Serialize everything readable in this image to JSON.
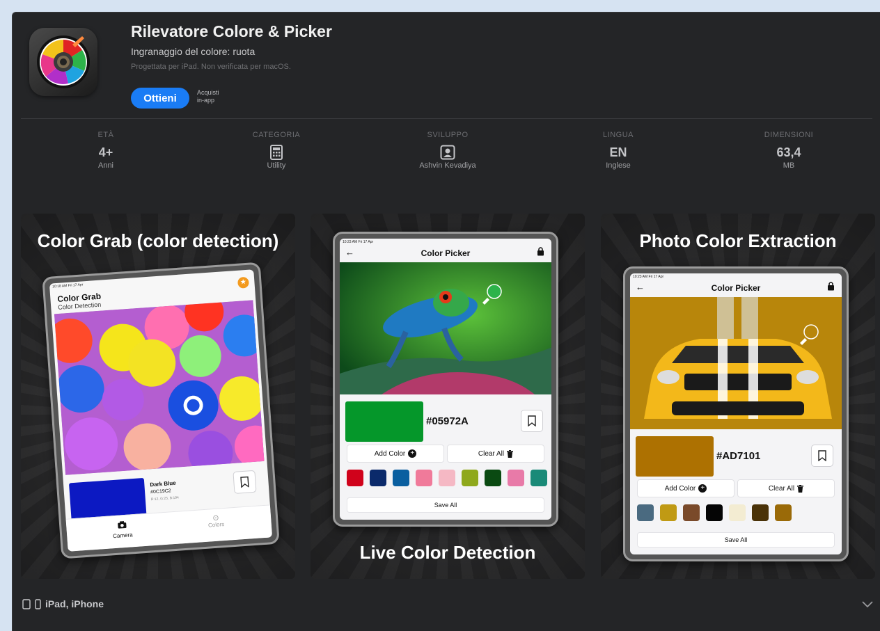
{
  "app": {
    "title": "Rilevatore Colore & Picker",
    "subtitle": "Ingranaggio del colore: ruota",
    "compat": "Progettata per iPad. Non verificata per macOS.",
    "get_label": "Ottieni",
    "iap_line1": "Acquisti",
    "iap_line2": "in-app",
    "accent": "#1a7cf5"
  },
  "info": [
    {
      "label": "ETÀ",
      "value": "4+",
      "sub": "Anni"
    },
    {
      "label": "CATEGORIA",
      "icon": "calculator-icon",
      "sub": "Utility"
    },
    {
      "label": "SVILUPPO",
      "icon": "person-icon",
      "sub": "Ashvin Kevadiya"
    },
    {
      "label": "LINGUA",
      "value": "EN",
      "sub": "Inglese"
    },
    {
      "label": "DIMENSIONI",
      "value": "63,4",
      "sub": "MB"
    }
  ],
  "shots": {
    "s1": {
      "title": "Color Grab (color detection)",
      "time": "10:18 AM  Fri 17 Apr",
      "heading": "Color Grab",
      "subheading": "Color Detection",
      "color_name": "Dark Blue",
      "color_hex": "#0C19C2",
      "color_rgb": "R:12, G:25, B:194",
      "swatch": "#0c19c2",
      "tab_camera": "Camera",
      "tab_colors": "Colors"
    },
    "s2": {
      "caption": "Live Color Detection",
      "time": "10:23 AM  Fri 17 Apr",
      "nav_title": "Color Picker",
      "hex": "#05972A",
      "swatch": "#05972a",
      "add_color": "Add Color",
      "clear_all": "Clear All",
      "save_all": "Save All",
      "palette": [
        "#d0021b",
        "#0b2a6b",
        "#0a5fa0",
        "#f07a9a",
        "#f5b8c4",
        "#8fa81c",
        "#0a4a12",
        "#e87aa8",
        "#1a8a78"
      ]
    },
    "s3": {
      "title": "Photo Color Extraction",
      "time": "10:23 AM  Fri 17 Apr",
      "nav_title": "Color Picker",
      "hex": "#AD7101",
      "swatch": "#ad7101",
      "add_color": "Add Color",
      "clear_all": "Clear All",
      "save_all": "Save All",
      "palette": [
        "#4a6a80",
        "#c09a14",
        "#7a4a2a",
        "#050505",
        "#f3ecd2",
        "#4a3208",
        "#9a6a08"
      ]
    }
  },
  "footer": {
    "devices": "iPad, iPhone"
  }
}
